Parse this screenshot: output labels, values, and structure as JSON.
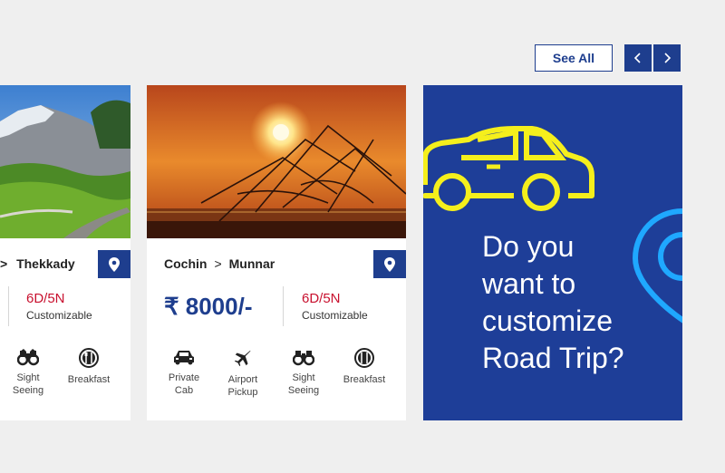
{
  "toolbar": {
    "see_all": "See All"
  },
  "cards": [
    {
      "from": "",
      "to": "Thekkady",
      "separator": ">",
      "duration": "6D/5N",
      "customizable": "Customizable",
      "amenities": [
        {
          "icon": "binoculars-icon",
          "label_1": "Sight",
          "label_2": "Seeing"
        },
        {
          "icon": "plate-icon",
          "label_1": "Breakfast",
          "label_2": ""
        }
      ]
    },
    {
      "from": "Cochin",
      "to": "Munnar",
      "separator": ">",
      "price": "₹ 8000/-",
      "duration": "6D/5N",
      "customizable": "Customizable",
      "amenities": [
        {
          "icon": "car-icon",
          "label_1": "Private",
          "label_2": "Cab"
        },
        {
          "icon": "airplane-icon",
          "label_1": "Airport",
          "label_2": "Pickup"
        },
        {
          "icon": "binoculars-icon",
          "label_1": "Sight",
          "label_2": "Seeing"
        },
        {
          "icon": "plate-icon",
          "label_1": "Breakfast",
          "label_2": ""
        }
      ]
    }
  ],
  "promo": {
    "line_1": "Do you",
    "line_2": "want to",
    "line_3": "customize",
    "line_4": "Road Trip?"
  },
  "colors": {
    "brand": "#1e3e8e",
    "accent_red": "#c8102e",
    "promo_yellow": "#f5ef1c",
    "promo_cyan": "#1fa8ff"
  }
}
